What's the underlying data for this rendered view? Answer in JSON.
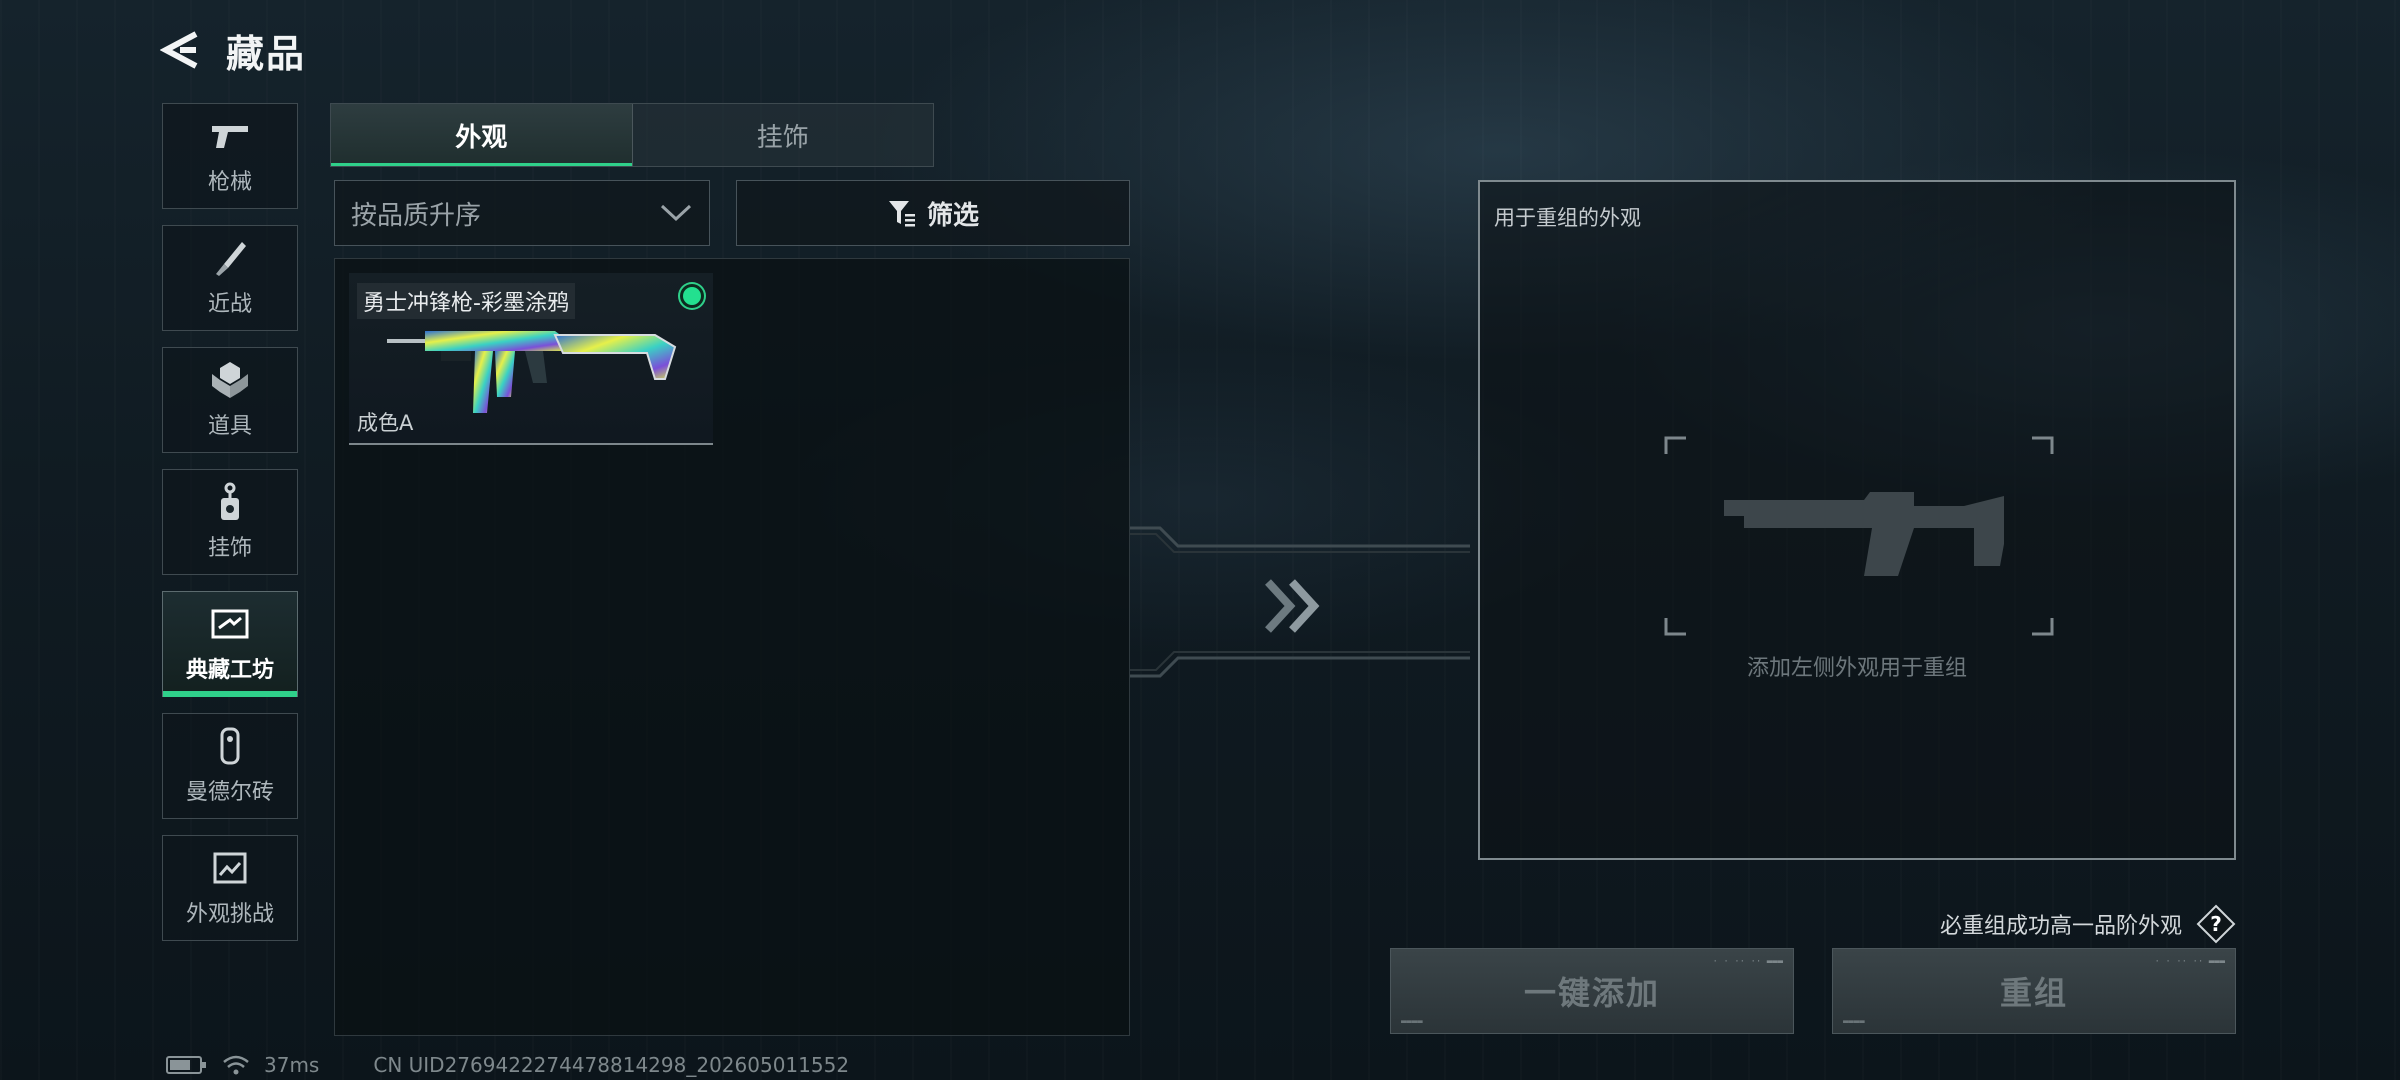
{
  "header": {
    "title": "藏品"
  },
  "categories": [
    {
      "id": "guns",
      "label": "枪械",
      "icon": "pistol-icon",
      "active": false
    },
    {
      "id": "melee",
      "label": "近战",
      "icon": "knife-icon",
      "active": false
    },
    {
      "id": "items",
      "label": "道具",
      "icon": "grenade-icon",
      "active": false
    },
    {
      "id": "charms",
      "label": "挂饰",
      "icon": "charm-icon",
      "active": false
    },
    {
      "id": "workshop",
      "label": "典藏工坊",
      "icon": "workshop-icon",
      "active": true
    },
    {
      "id": "mandel",
      "label": "曼德尔砖",
      "icon": "brick-icon",
      "active": false
    },
    {
      "id": "challenge",
      "label": "外观挑战",
      "icon": "challenge-icon",
      "active": false
    }
  ],
  "tabs": [
    {
      "label": "外观",
      "active": true
    },
    {
      "label": "挂饰",
      "active": false
    }
  ],
  "sort": {
    "selected": "按品质升序"
  },
  "filter": {
    "label": "筛选"
  },
  "inventory": [
    {
      "name": "勇士冲锋枪-彩墨涂鸦",
      "grade": "成色A",
      "selected": true,
      "status_color": "#23e08f"
    }
  ],
  "recombine": {
    "title": "用于重组的外观",
    "hint": "添加左侧外观用于重组",
    "rule": "必重组成功高一品阶外观",
    "add_all_label": "一键添加",
    "recombine_label": "重组"
  },
  "status": {
    "ping": "37ms",
    "uid": "CN UID2769422274478814298_202605011552"
  },
  "colors": {
    "accent": "#2fd08a"
  }
}
